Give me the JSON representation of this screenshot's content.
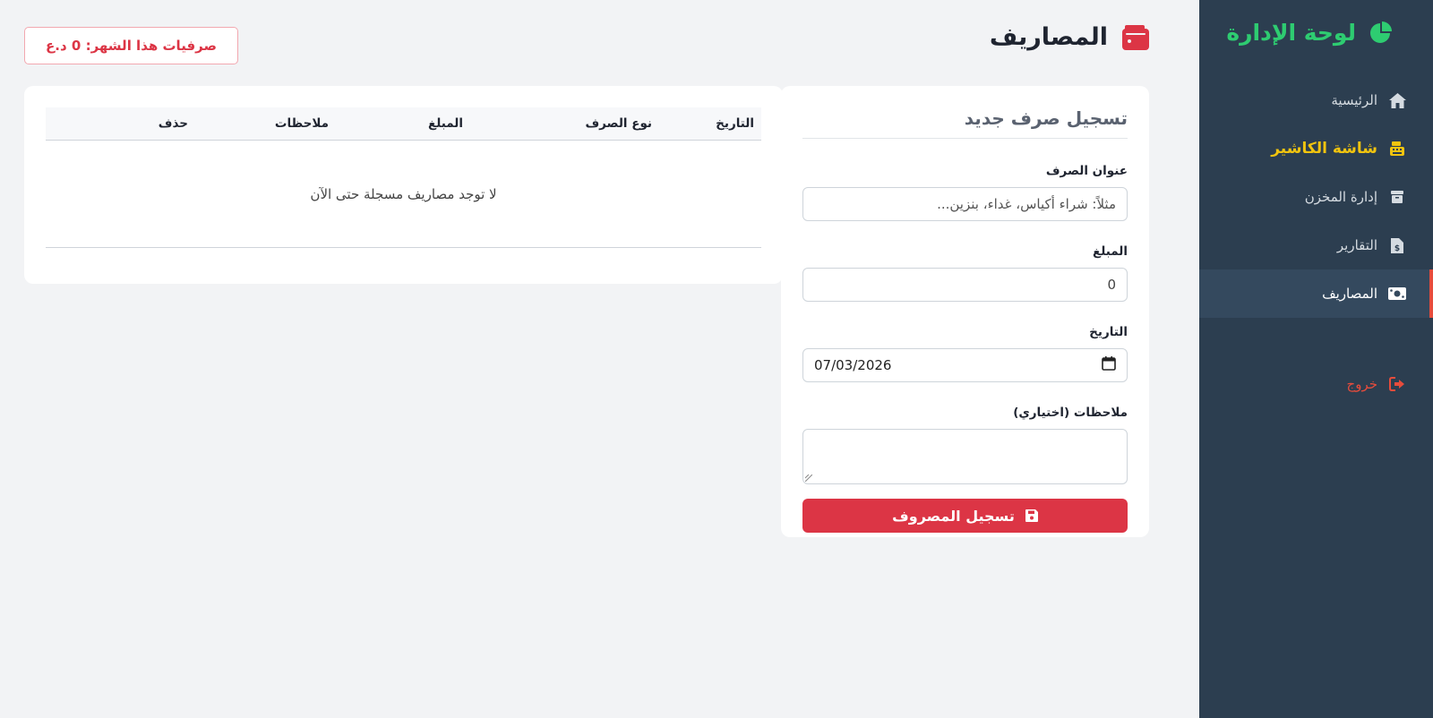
{
  "sidebar": {
    "brand": "لوحة الإدارة",
    "items": [
      {
        "label": "الرئيسية",
        "icon": "home-icon"
      },
      {
        "label": "شاشة الكاشير",
        "icon": "cash-register-icon"
      },
      {
        "label": "إدارة المخزن",
        "icon": "box-icon"
      },
      {
        "label": "التقارير",
        "icon": "invoice-icon"
      },
      {
        "label": "المصاريف",
        "icon": "money-bill-icon"
      }
    ],
    "logout": "خروج"
  },
  "header": {
    "title": "المصاريف",
    "month_badge": "صرفيات هذا الشهر: 0 د.ع"
  },
  "form": {
    "title": "تسجيل صرف جديد",
    "title_label": "عنوان الصرف",
    "title_placeholder": "مثلاً: شراء أكياس، غداء، بنزين...",
    "amount_label": "المبلغ",
    "amount_value": "0",
    "date_label": "التاريخ",
    "date_value": "07/03/2026",
    "notes_label": "ملاحظات (اختياري)",
    "notes_value": "",
    "submit_label": "تسجيل المصروف"
  },
  "table": {
    "columns": [
      "التاريخ",
      "نوع الصرف",
      "المبلغ",
      "ملاحظات",
      "حذف"
    ],
    "empty_message": "لا توجد مصاريف مسجلة حتى الآن"
  },
  "colors": {
    "sidebar_bg": "#2c3e50",
    "brand": "#2ecc71",
    "cashier": "#f1c40f",
    "danger": "#dc3545",
    "active_accent": "#e74c3c"
  }
}
